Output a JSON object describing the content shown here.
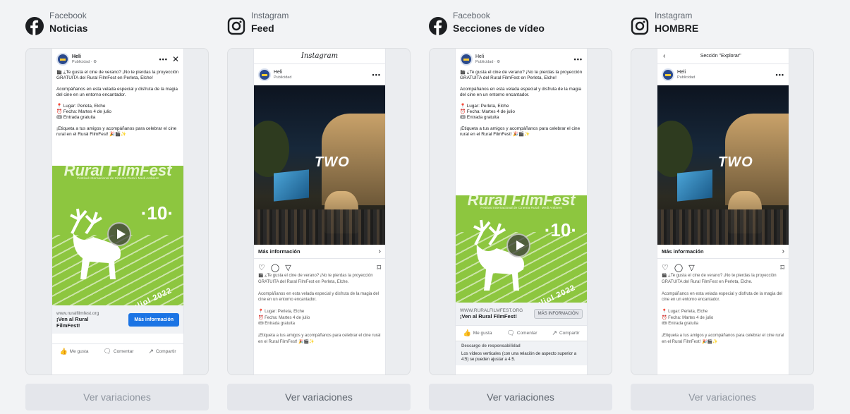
{
  "columns": [
    {
      "platform": "Facebook",
      "placement": "Noticias"
    },
    {
      "platform": "Instagram",
      "placement": "Feed"
    },
    {
      "platform": "Facebook",
      "placement": "Secciones de vídeo"
    },
    {
      "platform": "Instagram",
      "placement": "HOMBRE"
    }
  ],
  "ver_variaciones": "Ver variaciones",
  "advertiser": {
    "name": "Heli",
    "sponsored_fb": "Publicidad · ⚙",
    "sponsored_ig": "Publicidad"
  },
  "ad_text": "🎬 ¿Te gusta el cine de verano? ¡No te pierdas la proyección GRATUITA del Rural FilmFest en Perleta, Elche!\n\nAcompáñanos en esta velada especial y disfruta de la magia del cine en un entorno encantador.\n\n📍 Lugar: Perleta, Elche\n⏰ Fecha: Martes 4 de julio\n🎟 Entrada gratuita\n\n¡Etiqueta a tus amigos y acompáñanos para celebrar el cine rural en el Rural FilmFest! 🎉🎬✨",
  "ig_caption": "🎬 ¿Te gusta el cine de verano? ¡No te pierdas la proyección GRATUITA del Rural FilmFest en Perleta, Elche.\n\nAcompáñanos en esta velada especial y disfruta de la magia del cine en un entorno encantador.\n\n📍 Lugar: Perleta, Elche\n⏰ Fecha: Martes 4 de julio\n🎟 Entrada gratuita\n\n¡Etiqueta a tus amigos y acompáñanos para celebrar el cine rural en el Rural FilmFest! 🎉🎬✨",
  "poster": {
    "title": "Rural FilmFest",
    "subtitle": "Festival Internacional de Cinema Rural i Medi Ambient",
    "edition": "·10·",
    "date": "juliol 2022"
  },
  "photo_overlay": "TWO",
  "instagram_logo": "Instagram",
  "explore_label": "Sección \"Explorar\"",
  "more_info": "Más información",
  "fb_news": {
    "site": "www.ruralfilmfest.org",
    "title": "¡Ven al Rural FilmFest!",
    "cta": "Más información"
  },
  "fb_video": {
    "site": "WWW.RURALFILMFEST.ORG",
    "title": "¡Ven al Rural FilmFest!",
    "cta": "MÁS INFORMACIÓN"
  },
  "reactions": {
    "like": "Me gusta",
    "comment": "Comentar",
    "share": "Compartir"
  },
  "disclaimer": {
    "title": "Descargo de responsabilidad",
    "text": "Los vídeos verticales (con una relación de aspecto superior a 4:5) se pueden ajustar a 4:5."
  },
  "icons": {
    "facebook": "facebook-icon",
    "instagram": "instagram-icon",
    "play": "play-icon",
    "heart": "heart-icon",
    "comment": "comment-icon",
    "send": "send-icon",
    "bookmark": "bookmark-icon"
  },
  "colors": {
    "facebook_blue": "#1c1e21",
    "cta_blue": "#1b74e4",
    "poster_green": "#8dc63f"
  }
}
